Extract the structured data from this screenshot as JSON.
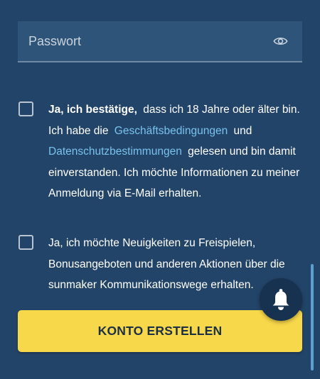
{
  "password": {
    "placeholder": "Passwort",
    "value": "",
    "toggle_icon": "eye-icon"
  },
  "consent_age_terms": {
    "checked": false,
    "bold_prefix": "Ja, ich bestätige,",
    "text_1": "dass ich 18 Jahre oder älter bin. Ich habe die",
    "terms_link": "Geschäftsbedingungen",
    "text_2": "und",
    "privacy_link": "Datenschutzbestimmungen",
    "text_3": "gelesen und bin damit einverstanden. Ich möchte Informationen zu meiner Anmeldung via E-Mail erhalten."
  },
  "consent_marketing": {
    "checked": false,
    "text": "Ja, ich möchte Neuigkeiten zu Freispielen, Bonusangeboten und anderen Aktionen über die sunmaker Kommunikationswege erhalten."
  },
  "submit": {
    "label": "KONTO ERSTELLEN"
  },
  "notification": {
    "icon": "bell-icon"
  },
  "colors": {
    "background": "#234469",
    "field": "#2f5479",
    "link": "#79c2ee",
    "button": "#f7d84a",
    "button_text": "#1b2f45",
    "scrollbar": "#5b9fd3"
  }
}
